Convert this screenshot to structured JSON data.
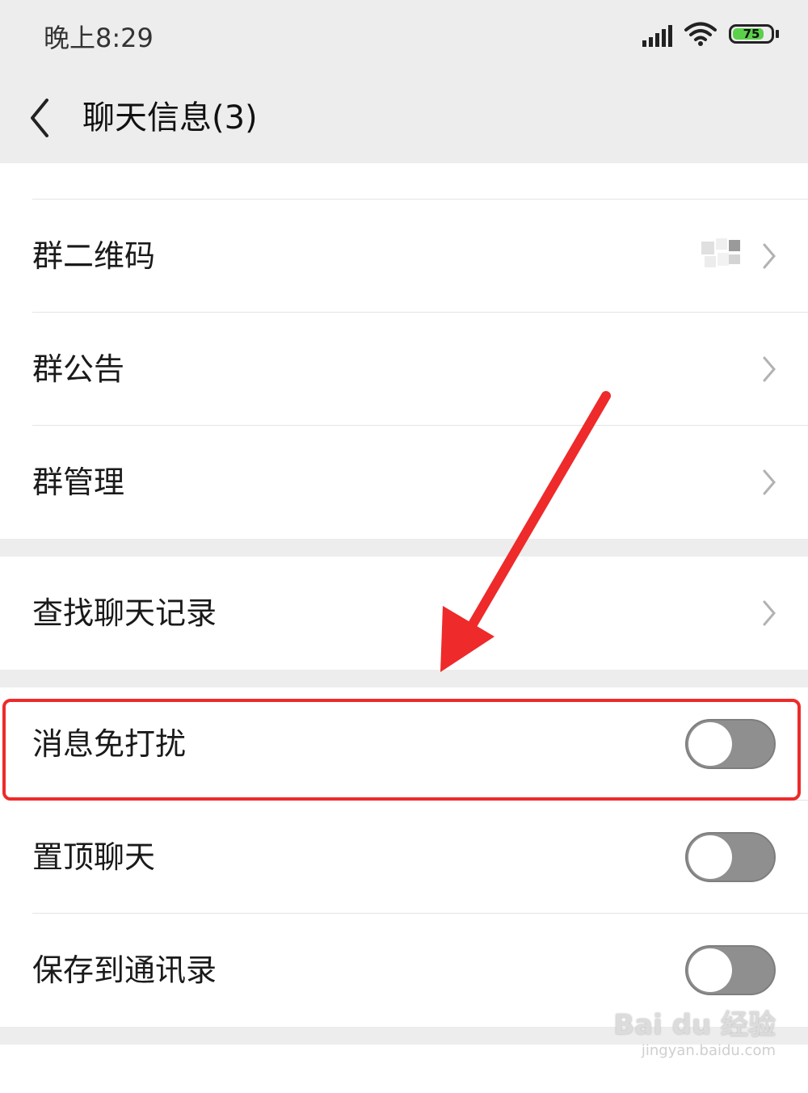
{
  "status_bar": {
    "time": "晚上8:29",
    "battery": "75"
  },
  "header": {
    "title": "聊天信息(3)"
  },
  "sections": {
    "group": [
      {
        "label": "群二维码"
      },
      {
        "label": "群公告"
      },
      {
        "label": "群管理"
      }
    ],
    "search": {
      "label": "查找聊天记录"
    },
    "toggles": [
      {
        "label": "消息免打扰"
      },
      {
        "label": "置顶聊天"
      },
      {
        "label": "保存到通讯录"
      }
    ]
  },
  "watermark": {
    "main": "Bai du 经验",
    "sub": "jingyan.baidu.com"
  },
  "colors": {
    "highlight": "#ee2a2a",
    "toggle_off": "#8f8f8f",
    "background": "#ededed"
  }
}
